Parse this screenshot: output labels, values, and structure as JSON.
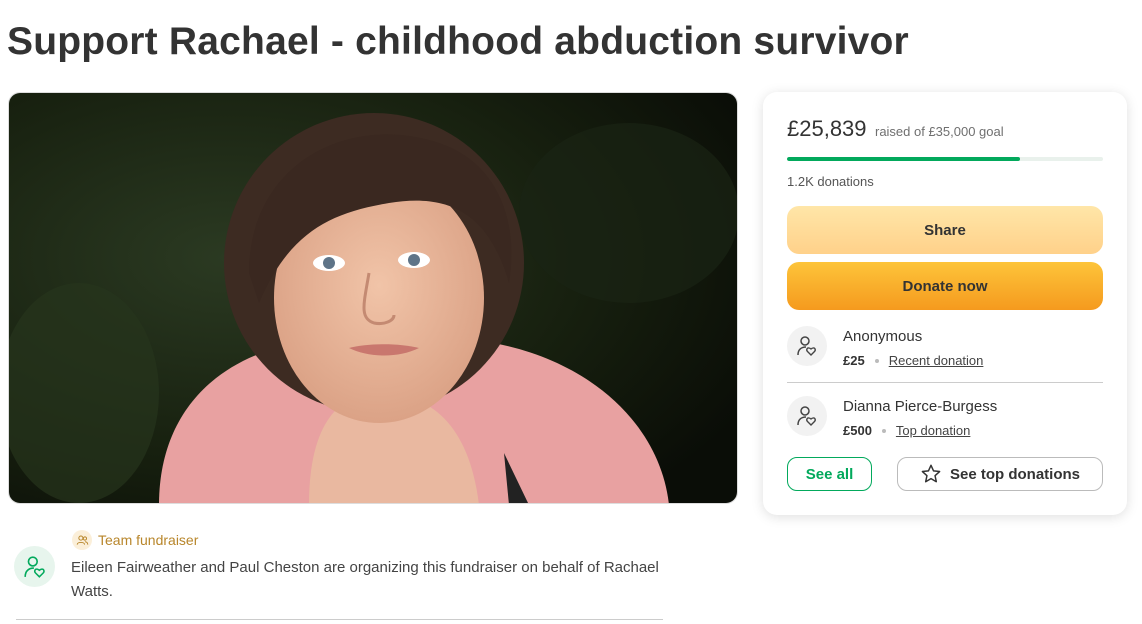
{
  "page": {
    "title": "Support Rachael - childhood abduction survivor"
  },
  "hero": {
    "image_icon": "portrait-photo"
  },
  "stats": {
    "amount": "£25,839",
    "goal_text": "raised of £35,000 goal",
    "progress": 0.738,
    "donations_count": "1.2K donations"
  },
  "buttons": {
    "share": "Share",
    "donate": "Donate now",
    "see_all": "See all",
    "see_top": "See top donations"
  },
  "donations": [
    {
      "name": "Anonymous",
      "amount": "£25",
      "tag": "Recent donation",
      "icon": "heart-person-icon"
    },
    {
      "name": "Dianna Pierce-Burgess",
      "amount": "£500",
      "tag": "Top donation",
      "icon": "heart-person-icon"
    }
  ],
  "organizer": {
    "team_label": "Team fundraiser",
    "text": "Eileen Fairweather and Paul Cheston are organizing this fundraiser on behalf of Rachael Watts."
  },
  "colors": {
    "accent_green": "#02a95c",
    "share_yellow": "#ffd18a",
    "donate_orange": "#f59a1e",
    "team_gold": "#b8862b"
  }
}
